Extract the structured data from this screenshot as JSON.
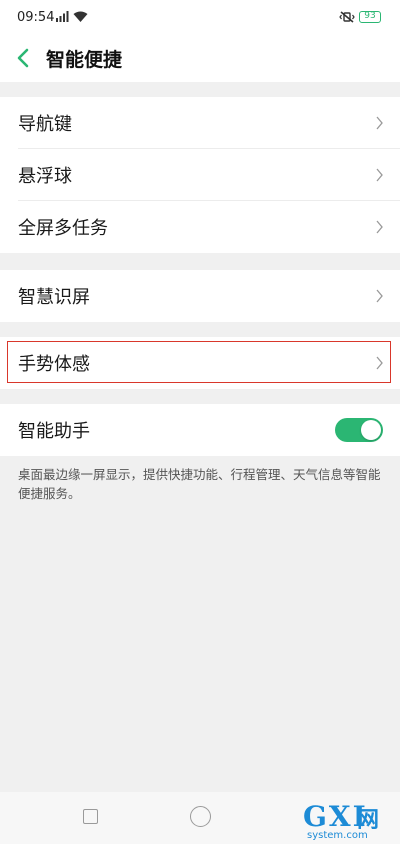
{
  "status_bar": {
    "time": "09:54",
    "battery": "93"
  },
  "header": {
    "title": "智能便捷"
  },
  "groups": [
    {
      "items": [
        {
          "label": "导航键"
        },
        {
          "label": "悬浮球"
        },
        {
          "label": "全屏多任务"
        }
      ]
    },
    {
      "items": [
        {
          "label": "智慧识屏"
        }
      ]
    },
    {
      "items": [
        {
          "label": "手势体感"
        }
      ]
    },
    {
      "items": [
        {
          "label": "智能助手",
          "toggle_on": true
        }
      ]
    }
  ],
  "assistant_description": "桌面最边缘一屏显示，提供快捷功能、行程管理、天气信息等智能便捷服务。",
  "colors": {
    "accent": "#2bb673",
    "highlight": "#d9372b",
    "watermark": "#1d8bd6"
  },
  "watermark": {
    "brand": "GXI",
    "net": "网",
    "domain": "system.com"
  }
}
